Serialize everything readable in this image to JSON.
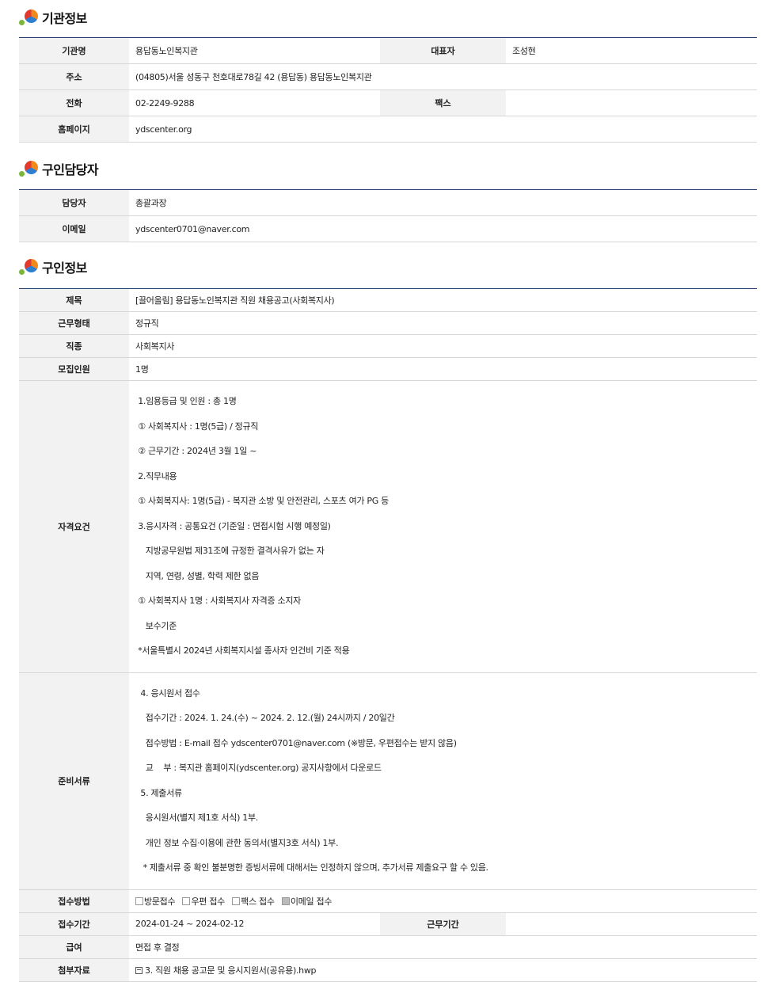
{
  "sections": {
    "org": {
      "title": "기관정보",
      "rows": {
        "name_label": "기관명",
        "name": "용답동노인복지관",
        "rep_label": "대표자",
        "rep": "조성현",
        "addr_label": "주소",
        "addr": "(04805)서울 성동구 천호대로78길 42 (용답동) 용답동노인복지관",
        "tel_label": "전화",
        "tel": "02-2249-9288",
        "fax_label": "팩스",
        "fax": "",
        "home_label": "홈페이지",
        "home": "ydscenter.org"
      }
    },
    "contact": {
      "title": "구인담당자",
      "rows": {
        "manager_label": "담당자",
        "manager": "총괄과장",
        "email_label": "이메일",
        "email": "ydscenter0701@naver.com"
      }
    },
    "job": {
      "title": "구인정보",
      "rows": {
        "subject_label": "제목",
        "subject": "[끌어올림] 용답동노인복지관 직원 채용공고(사회복지사)",
        "type_label": "근무형태",
        "type": "정규직",
        "occupation_label": "직종",
        "occupation": "사회복지사",
        "count_label": "모집인원",
        "count": "1명",
        "qual_label": "자격요건",
        "qual_lines": [
          " 1.임용등급 및 인원 : 총 1명",
          " ① 사회복지사 : 1명(5급) / 정규직",
          " ② 근무기간 : 2024년 3월 1일 ~",
          " 2.직무내용",
          " ① 사회복지사: 1명(5급) - 복지관 소방 및 안전관리, 스포츠 여가 PG 등",
          " 3.응시자격 : 공통요건 (기준일 : 면접시험 시행 예정일)",
          "    지방공무원법 제31조에 규정한 결격사유가 없는 자",
          "    지역, 연령, 성별, 학력 제한 없음",
          " ① 사회복지사 1명 : 사회복지사 자격증 소지자",
          "    보수기준",
          " *서울특별시 2024년 사회복지시설 종사자 인건비 기준 적용"
        ],
        "docs_label": "준비서류",
        "docs_lines": [
          "  4. 응시원서 접수",
          "    접수기간 : 2024. 1. 24.(수) ~ 2024. 2. 12.(월) 24시까지 / 20일간",
          "    접수방법 : E-mail 접수 ydscenter0701@naver.com (※방문, 우편접수는 받지 않음)",
          "    교    부 : 복지관 홈페이지(ydscenter.org) 공지사항에서 다운로드",
          "  5. 제출서류",
          "    응시원서(별지 제1호 서식) 1부.",
          "    개인 정보 수집·이용에 관한 동의서(별지3호 서식) 1부.",
          "   * 제출서류 중 확인 불분명한 증빙서류에 대해서는 인정하지 않으며, 추가서류 제출요구 할 수 있음."
        ],
        "method_label": "접수방법",
        "methods": [
          "방문접수",
          "우편 접수",
          "팩스 접수",
          "이메일 접수"
        ],
        "period_label": "접수기간",
        "period": "2024-01-24 ~ 2024-02-12",
        "work_period_label": "근무기간",
        "work_period": "",
        "pay_label": "급여",
        "pay": "면접 후 결정",
        "attach_label": "첨부자료",
        "attach": "3. 직원 채용 공고문 및 응시지원서(공유용).hwp"
      }
    }
  }
}
